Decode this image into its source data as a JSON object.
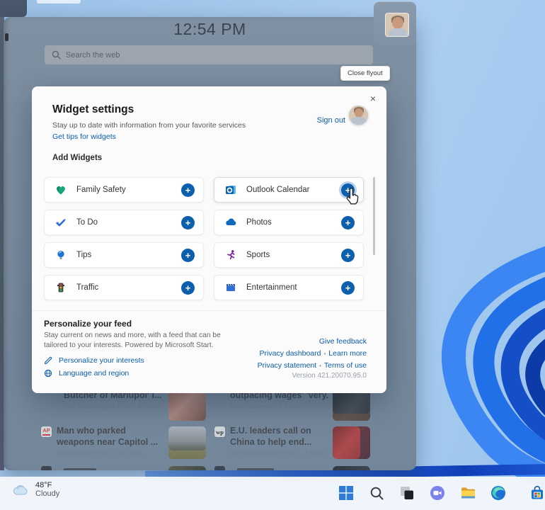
{
  "panel": {
    "time": "12:54 PM",
    "search": {
      "placeholder": "Search the web"
    }
  },
  "tooltip": {
    "label": "Close flyout"
  },
  "dialog": {
    "close_glyph": "×",
    "title": "Widget settings",
    "subtitle": "Stay up to date with information from your favorite services",
    "tips_link": "Get tips for widgets",
    "sign_out_label": "Sign out",
    "add_widgets_heading": "Add Widgets",
    "plus_glyph": "+",
    "widgets": [
      {
        "label": "Family Safety"
      },
      {
        "label": "Outlook Calendar"
      },
      {
        "label": "To Do"
      },
      {
        "label": "Photos"
      },
      {
        "label": "Tips"
      },
      {
        "label": "Sports"
      },
      {
        "label": "Traffic"
      },
      {
        "label": "Entertainment"
      }
    ],
    "personalize": {
      "heading": "Personalize your feed",
      "body": "Stay current on news and more, with a feed that can be tailored to your interests. Powered by Microsoft Start.",
      "interests_link": "Personalize your interests",
      "language_link": "Language and region",
      "give_feedback": "Give feedback",
      "privacy_dashboard": "Privacy dashboard",
      "learn_more": "Learn more",
      "privacy_statement": "Privacy statement",
      "terms_of_use": "Terms of use",
      "separator": "•",
      "version": "Version 421.20070.95.0"
    }
  },
  "feed": {
    "articles": [
      {
        "title": "Butcher of Mariupol' l...",
        "source": "The Washington Post · 47 mins"
      },
      {
        "title": "outpacing wages' 'very...",
        "source": "Fox Business · 1 hour"
      },
      {
        "title": "Man who parked weapons near Capitol ...",
        "source": "Associated Press · 52 mins",
        "badge": "AP"
      },
      {
        "title": "E.U. leaders call on China to help end...",
        "source": "The Washington Post · 3 hours",
        "badge": "wp"
      }
    ]
  },
  "taskbar": {
    "weather": {
      "temp": "48°F",
      "condition": "Cloudy"
    }
  },
  "colors": {
    "accent": "#0b5cab",
    "plus_button": "#0b5fad",
    "panel": "#71849a"
  }
}
